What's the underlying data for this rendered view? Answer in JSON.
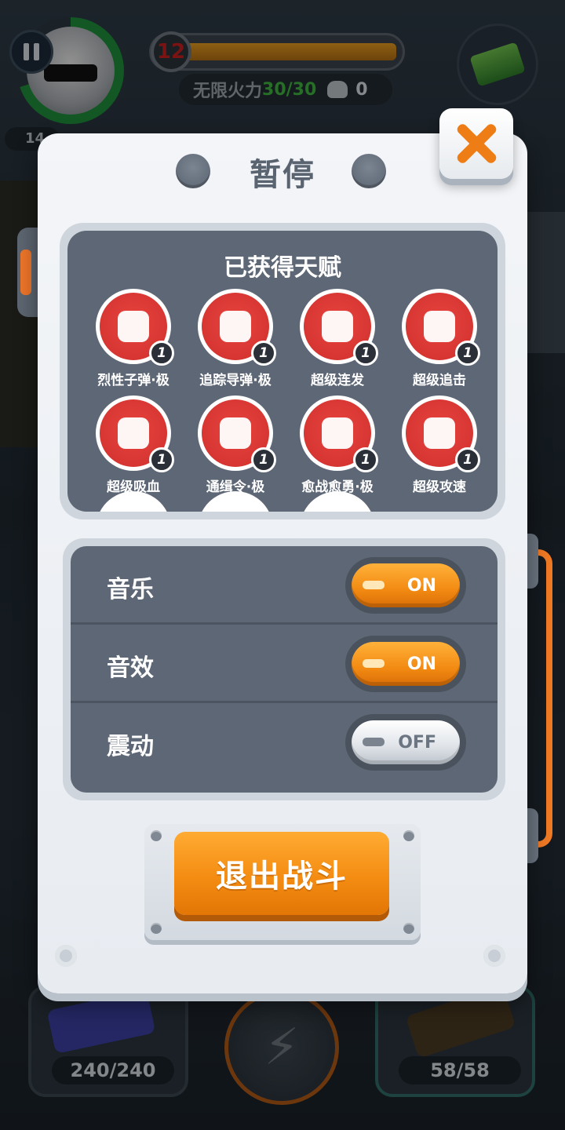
{
  "hud": {
    "level": "12",
    "hp_text": "14",
    "ammo_mode": "无限火力",
    "ammo_current": "30/30",
    "kills": "0"
  },
  "panel": {
    "title": "暂停",
    "talents_title": "已获得天赋",
    "talents": [
      {
        "name": "烈性子弹·极",
        "level": "1",
        "icon": "skull-bullet-icon"
      },
      {
        "name": "追踪导弹·极",
        "level": "1",
        "icon": "homing-missile-icon"
      },
      {
        "name": "超级连发",
        "level": "1",
        "icon": "rapid-fire-icon"
      },
      {
        "name": "超级追击",
        "level": "1",
        "icon": "chase-gun-icon"
      },
      {
        "name": "超级吸血",
        "level": "1",
        "icon": "lifesteal-icon"
      },
      {
        "name": "通缉令·极",
        "level": "1",
        "icon": "wanted-poster-icon"
      },
      {
        "name": "愈战愈勇·极",
        "level": "1",
        "icon": "fist-icon"
      },
      {
        "name": "超级攻速",
        "level": "1",
        "icon": "stopwatch-gun-icon"
      }
    ],
    "settings": [
      {
        "label": "音乐",
        "state": "ON"
      },
      {
        "label": "音效",
        "state": "ON"
      },
      {
        "label": "震动",
        "state": "OFF"
      }
    ],
    "exit_label": "退出战斗"
  },
  "weapons": {
    "left_ammo": "240/240",
    "right_ammo": "58/58"
  },
  "colors": {
    "accent": "#f28a12",
    "talent_red": "#d9322f",
    "panel_slate": "#5e6776"
  }
}
